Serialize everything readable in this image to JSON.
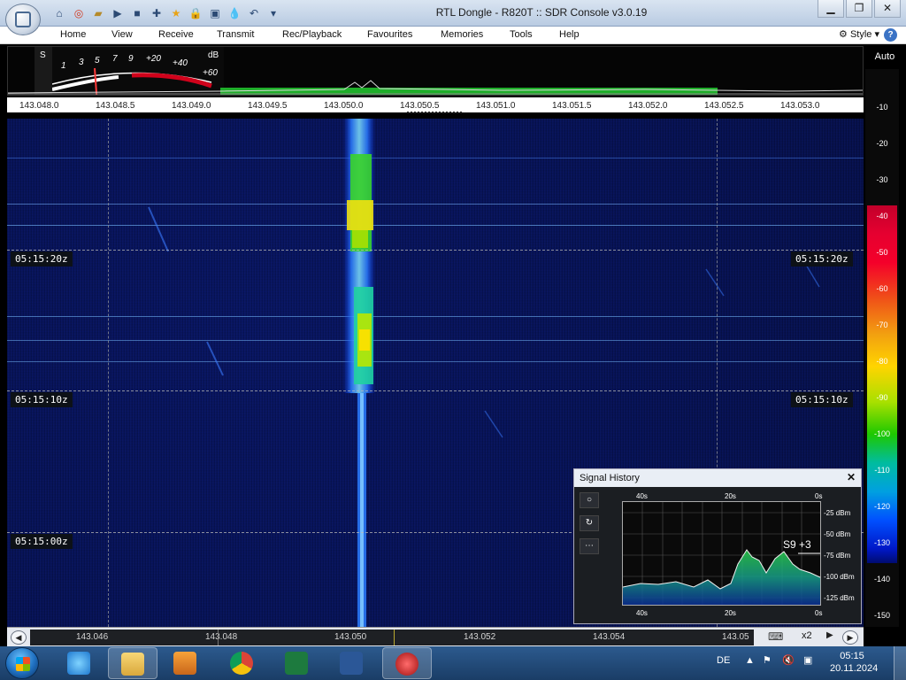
{
  "window": {
    "title": "RTL Dongle - R820T :: SDR Console v3.0.19",
    "controls": [
      "minimize-icon",
      "restore-icon",
      "close-icon"
    ]
  },
  "quick_access": [
    "home-icon",
    "help-ring-icon",
    "folder-icon",
    "play-icon",
    "stop-icon",
    "add-icon",
    "star-icon",
    "lock-icon",
    "camera-icon",
    "drop-icon",
    "undo-icon",
    "dropdown-icon"
  ],
  "menu": {
    "items": [
      "Home",
      "View",
      "Receive",
      "Transmit",
      "Rec/Playback",
      "Favourites",
      "Memories",
      "Tools",
      "Help"
    ],
    "style_label": "Style"
  },
  "meter": {
    "s_label": "S",
    "scale": [
      "1",
      "3",
      "5",
      "7",
      "9",
      "+20",
      "+40",
      "+60"
    ],
    "unit": "dB"
  },
  "spectrum": {
    "auto_label": "Auto"
  },
  "frequency_axis": [
    "143.048.0",
    "143.048.5",
    "143.049.0",
    "143.049.5",
    "143.050.0",
    "143.050.5",
    "143.051.0",
    "143.051.5",
    "143.052.0",
    "143.052.5",
    "143.053.0"
  ],
  "waterfall": {
    "time_labels": [
      "05:15:20z",
      "05:15:10z",
      "05:15:00z"
    ]
  },
  "db_scale": [
    "-10",
    "-20",
    "-30",
    "-40",
    "-50",
    "-60",
    "-70",
    "-80",
    "-90",
    "-100",
    "-110",
    "-120",
    "-130",
    "-140",
    "-150"
  ],
  "signal_history": {
    "title": "Signal History",
    "x_labels": [
      "40s",
      "20s",
      "0s"
    ],
    "y_labels": [
      "-25 dBm",
      "-50 dBm",
      "-75 dBm",
      "-100 dBm",
      "-125 dBm"
    ],
    "current_value": "S9 +3",
    "buttons": [
      "record-icon",
      "refresh-icon",
      "more-icon"
    ]
  },
  "bottom_bar": {
    "frequencies": [
      "143.046",
      "143.048",
      "143.050",
      "143.052",
      "143.054",
      "143.05"
    ],
    "zoom": "x2"
  },
  "taskbar": {
    "apps": [
      "start-orb",
      "internet-explorer-icon",
      "file-explorer-icon",
      "media-player-icon",
      "chrome-icon",
      "excel-icon",
      "word-icon",
      "sdr-console-icon"
    ],
    "language": "DE",
    "time": "05:15",
    "date": "20.11.2024"
  }
}
